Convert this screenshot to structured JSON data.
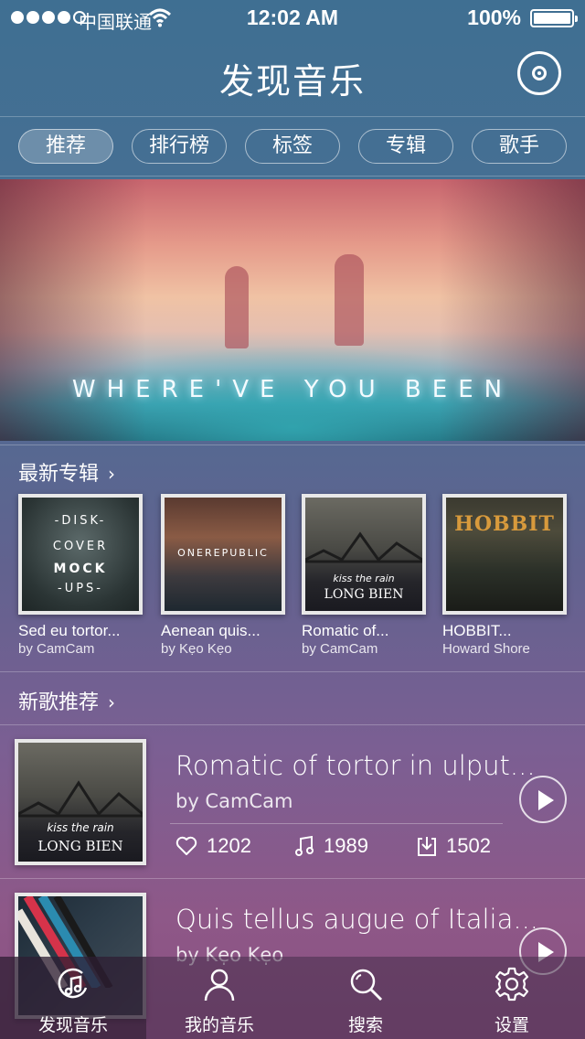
{
  "status_bar": {
    "carrier": "中国联通",
    "time": "12:02 AM",
    "battery": "100%",
    "signal_bars_filled": 4,
    "signal_bars_total": 5
  },
  "header": {
    "title": "发现音乐",
    "right_icon": "disc-icon"
  },
  "tabs": [
    {
      "label": "推荐",
      "active": true
    },
    {
      "label": "排行榜",
      "active": false
    },
    {
      "label": "标签",
      "active": false
    },
    {
      "label": "专辑",
      "active": false
    },
    {
      "label": "歌手",
      "active": false
    }
  ],
  "banner": {
    "text": "WHERE'VE YOU BEEN"
  },
  "new_albums": {
    "title": "最新专辑",
    "items": [
      {
        "name": "Sed eu tortor...",
        "artist": "by CamCam",
        "cover_text": [
          "-DISK-",
          "COVER",
          "MOCK",
          "-UPS-"
        ]
      },
      {
        "name": "Aenean quis...",
        "artist": "by Kẹo Kẹo",
        "cover_text": [
          "ONEREPUBLIC"
        ]
      },
      {
        "name": "Romatic of...",
        "artist": "by CamCam",
        "cover_text": [
          "kiss the rain",
          "LONG BIEN"
        ]
      },
      {
        "name": "HOBBIT...",
        "artist": "Howard Shore",
        "cover_text": [
          "HOBBIT"
        ]
      }
    ]
  },
  "new_songs": {
    "title": "新歌推荐",
    "items": [
      {
        "title": "Romatic of tortor in ulput...",
        "by": "by CamCam",
        "likes": "1202",
        "plays": "1989",
        "downloads": "1502",
        "cover_text": [
          "kiss the rain",
          "LONG BIEN"
        ]
      },
      {
        "title": "Quis tellus augue of Italia...",
        "by": "by Kẹo Kẹo"
      }
    ]
  },
  "tabbar": [
    {
      "label": "发现音乐",
      "icon": "music-discover-icon",
      "active": true
    },
    {
      "label": "我的音乐",
      "icon": "user-icon",
      "active": false
    },
    {
      "label": "搜索",
      "icon": "search-icon",
      "active": false
    },
    {
      "label": "设置",
      "icon": "gear-icon",
      "active": false
    }
  ]
}
